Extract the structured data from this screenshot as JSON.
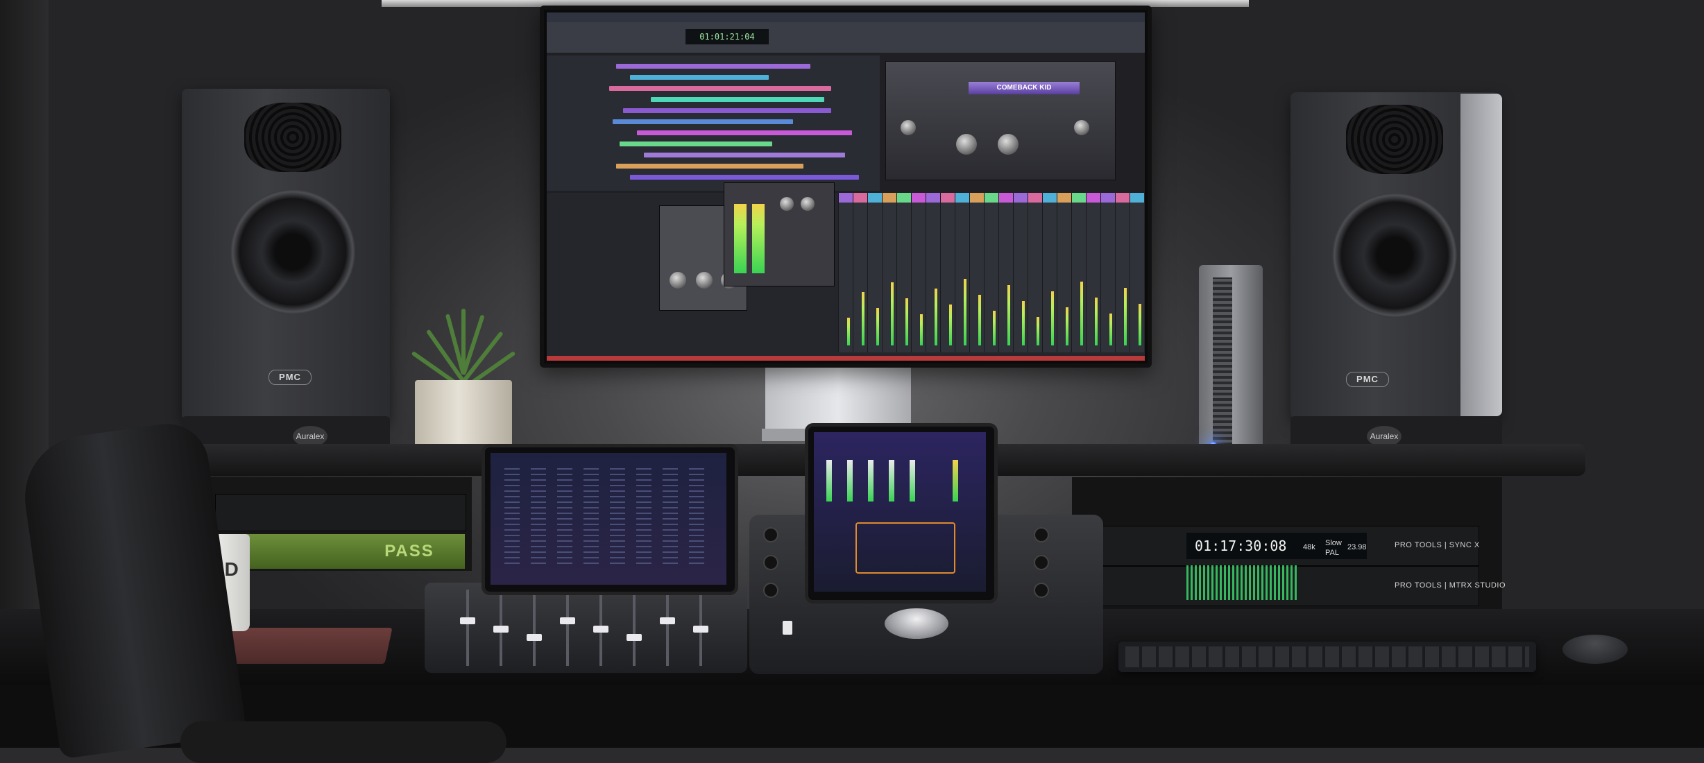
{
  "scene": "music production studio desk",
  "monitor": {
    "screen_plugin_title": "COMEBACK KID",
    "timecode": "01:01:21:04"
  },
  "speakers": {
    "brand": "PMC",
    "stand_brand": "Auralex"
  },
  "rack": {
    "sync_unit": {
      "timecode": "01:17:30:08",
      "rate": "48k",
      "ref_label": "Slow PAL",
      "fps": "23.98",
      "model_label": "PRO TOOLS | SYNC X"
    },
    "mtrx_unit": {
      "model_label": "PRO TOOLS | MTRX STUDIO"
    },
    "green_unit_label": "PASS"
  },
  "mug": {
    "logo": "AVID"
  },
  "colors": {
    "wall": "#4a4a4c",
    "desk": "#141415",
    "led_blue": "#4f7dff",
    "meter_green": "#39d353",
    "plugin_purple": "#7b5fc4"
  }
}
